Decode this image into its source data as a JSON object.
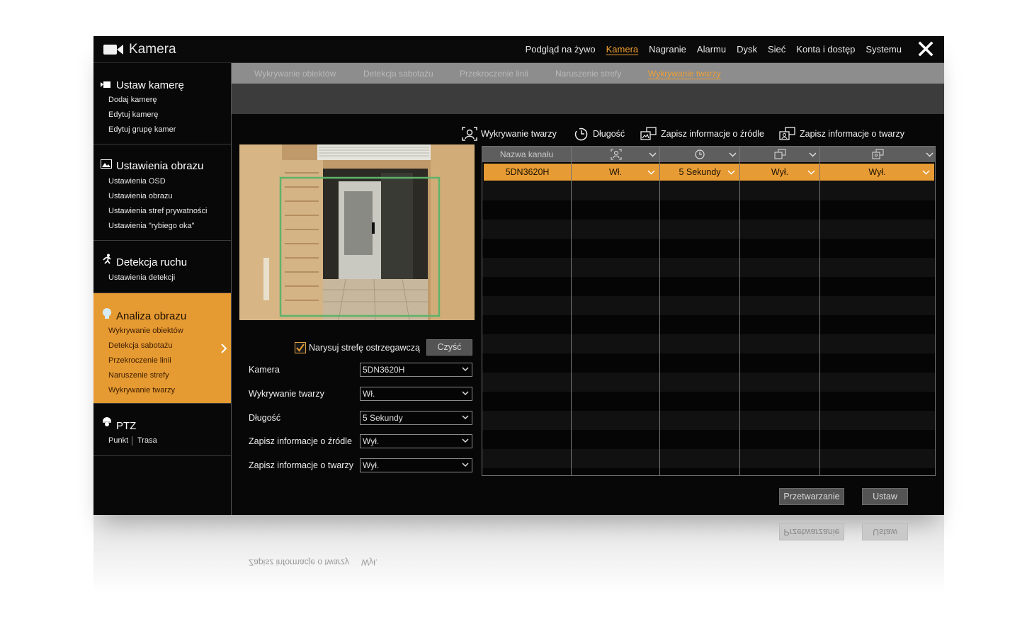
{
  "app": {
    "title": "Kamera"
  },
  "nav": {
    "items": [
      "Podgląd na żywo",
      "Kamera",
      "Nagranie",
      "Alarmu",
      "Dysk",
      "Sieć",
      "Konta i dostęp",
      "Systemu"
    ],
    "active": "Kamera"
  },
  "sidebar": {
    "groups": [
      {
        "title": "Ustaw kamerę",
        "icon": "camera-icon",
        "items": [
          "Dodaj kamerę",
          "Edytuj kamerę",
          "Edytuj grupę kamer"
        ]
      },
      {
        "title": "Ustawienia obrazu",
        "icon": "image-icon",
        "items": [
          "Ustawienia OSD",
          "Ustawienia obrazu",
          "Ustawienia stref prywatności",
          "Ustawienia \"rybiego oka\""
        ]
      },
      {
        "title": "Detekcja ruchu",
        "icon": "running-person-icon",
        "items": [
          "Ustawienia detekcji"
        ]
      },
      {
        "title": "Analiza obrazu",
        "icon": "analysis-head-icon",
        "items": [
          "Wykrywanie obiektów",
          "Detekcja sabotażu",
          "Przekroczenie linii",
          "Naruszenie strefy",
          "Wykrywanie twarzy"
        ]
      },
      {
        "title": "PTZ",
        "icon": "ptz-dome-icon",
        "items": [
          "Punkt",
          "Trasa"
        ]
      }
    ],
    "active_group": "Analiza obrazu"
  },
  "subtabs": {
    "items": [
      "Wykrywanie obiektów",
      "Detekcja sabotażu",
      "Przekroczenie linii",
      "Naruszenie strefy",
      "Wykrywanie twarzy"
    ],
    "active": "Wykrywanie twarzy"
  },
  "options_header": {
    "face_detect": "Wykrywanie twarzy",
    "duration": "Długość",
    "save_source": "Zapisz informacje o źródle",
    "save_face": "Zapisz informacje o twarzy"
  },
  "form": {
    "draw_zone_label": "Narysuj strefę ostrzegawczą",
    "draw_zone_checked": true,
    "clear_button": "Czyść",
    "camera_label": "Kamera",
    "camera_value": "5DN3620H",
    "face_label": "Wykrywanie twarzy",
    "face_value": "Wł.",
    "duration_label": "Długość",
    "duration_value": "5 Sekundy",
    "save_source_label": "Zapisz informacje o źródle",
    "save_source_value": "Wył.",
    "save_face_label": "Zapisz informacje o twarzy",
    "save_face_value": "Wył."
  },
  "table": {
    "header_channel": "Nazwa kanału",
    "row": {
      "channel": "5DN3620H",
      "face": "Wł.",
      "duration": "5 Sekundy",
      "save_source": "Wył.",
      "save_face": "Wył."
    }
  },
  "buttons": {
    "process": "Przetwarzanie",
    "set": "Ustaw"
  },
  "colors": {
    "accent": "#e69a32",
    "background": "#070707",
    "header_grey": "#8d8d8d"
  }
}
